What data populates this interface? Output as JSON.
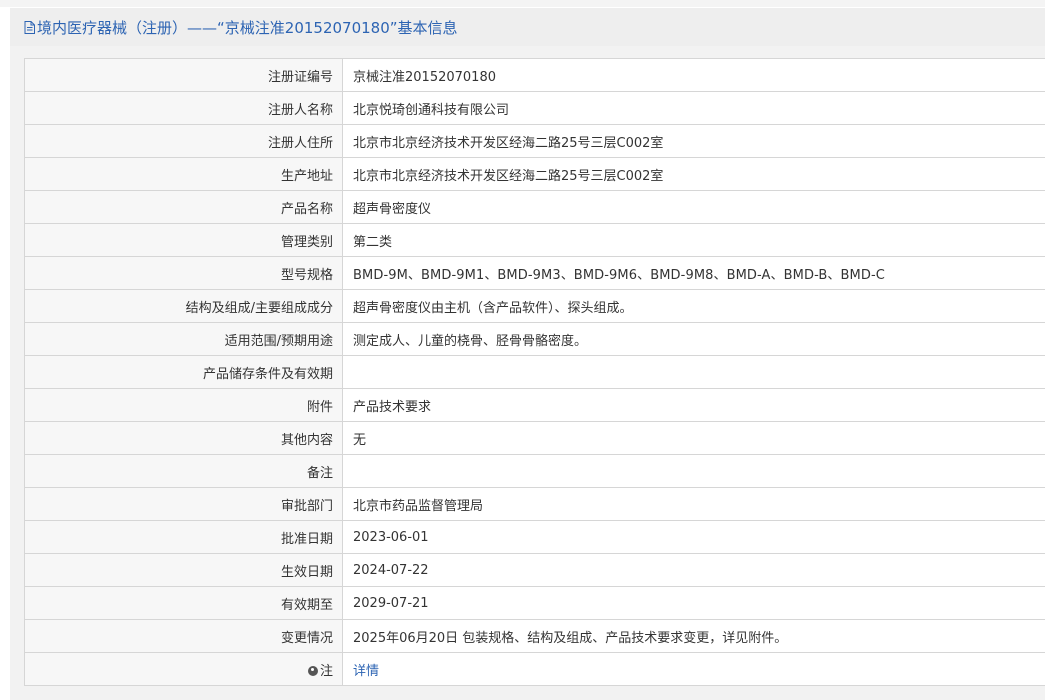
{
  "header": {
    "icon": "document-icon",
    "title": "境内医疗器械（注册）——“京械注准20152070180”基本信息"
  },
  "rows": [
    {
      "label": "注册证编号",
      "value": "京械注准20152070180"
    },
    {
      "label": "注册人名称",
      "value": "北京悦琦创通科技有限公司"
    },
    {
      "label": "注册人住所",
      "value": "北京市北京经济技术开发区经海二路25号三层C002室"
    },
    {
      "label": "生产地址",
      "value": "北京市北京经济技术开发区经海二路25号三层C002室"
    },
    {
      "label": "产品名称",
      "value": "超声骨密度仪"
    },
    {
      "label": "管理类别",
      "value": "第二类"
    },
    {
      "label": "型号规格",
      "value": "BMD-9M、BMD-9M1、BMD-9M3、BMD-9M6、BMD-9M8、BMD-A、BMD-B、BMD-C"
    },
    {
      "label": "结构及组成/主要组成成分",
      "value": "超声骨密度仪由主机（含产品软件）、探头组成。"
    },
    {
      "label": "适用范围/预期用途",
      "value": "测定成人、儿童的桡骨、胫骨骨骼密度。"
    },
    {
      "label": "产品储存条件及有效期",
      "value": ""
    },
    {
      "label": "附件",
      "value": "产品技术要求"
    },
    {
      "label": "其他内容",
      "value": "无"
    },
    {
      "label": "备注",
      "value": ""
    },
    {
      "label": "审批部门",
      "value": "北京市药品监督管理局"
    },
    {
      "label": "批准日期",
      "value": "2023-06-01"
    },
    {
      "label": "生效日期",
      "value": "2024-07-22"
    },
    {
      "label": "有效期至",
      "value": "2029-07-21"
    },
    {
      "label": "变更情况",
      "value": "2025年06月20日 包装规格、结构及组成、产品技术要求变更，详见附件。"
    }
  ],
  "note_row": {
    "icon": "note-dot-icon",
    "label": "注",
    "link_text": "详情"
  },
  "colors": {
    "accent": "#2d64b3",
    "label_bg": "#f7f7f7",
    "border": "#d6d6d6",
    "header_bg": "#eeeeee"
  }
}
